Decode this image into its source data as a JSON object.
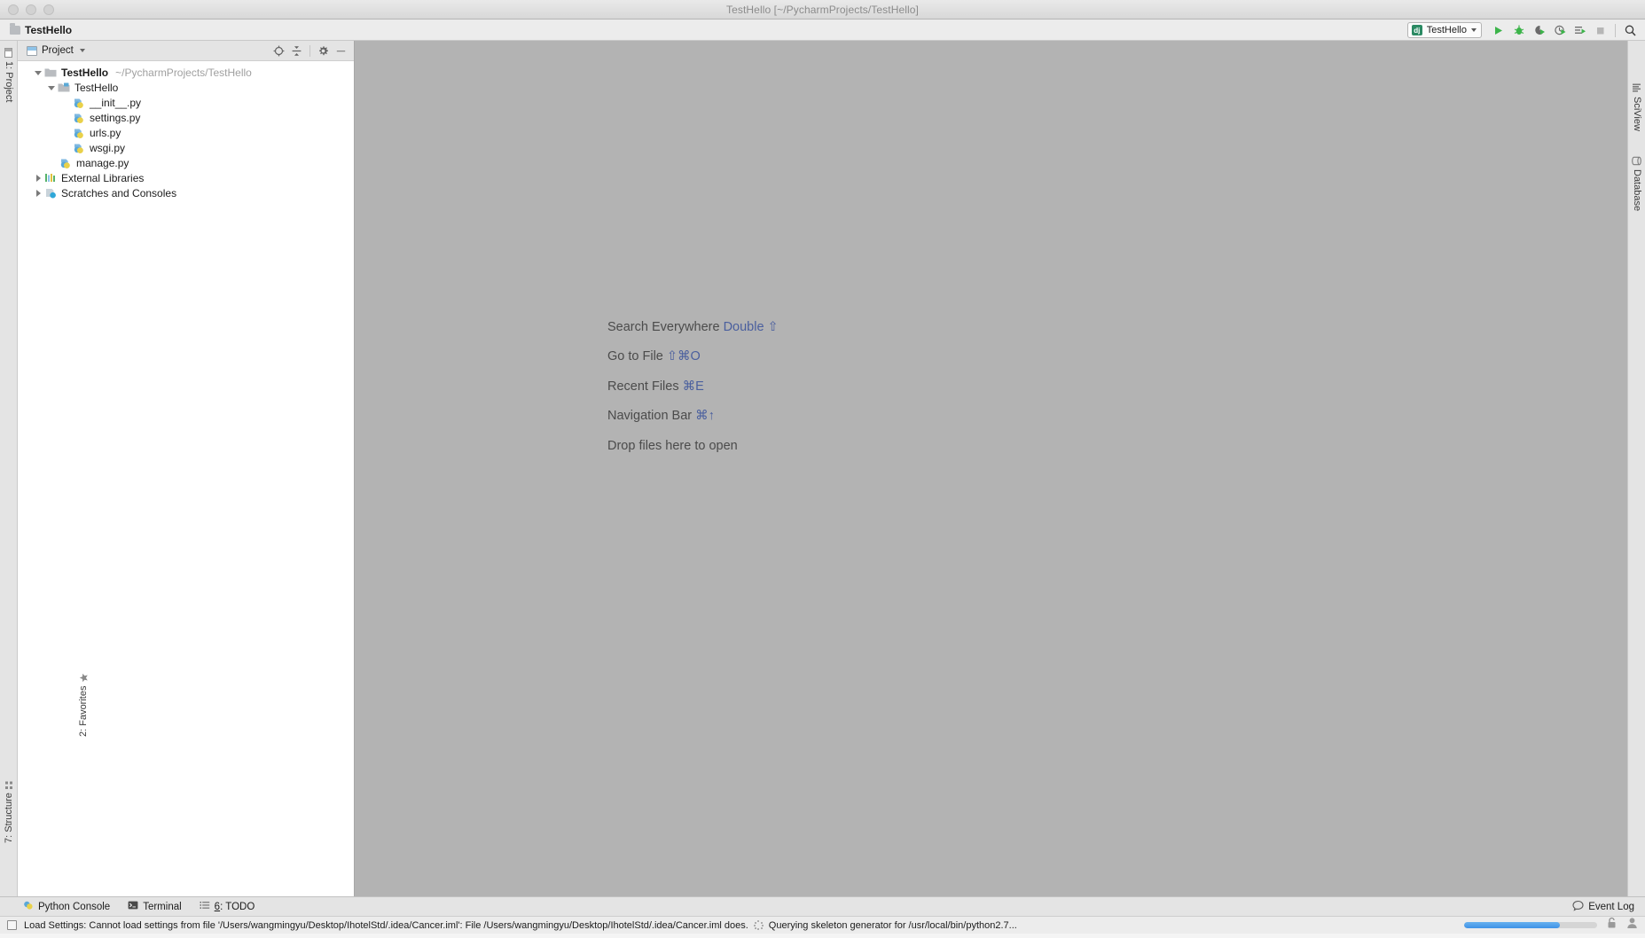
{
  "window": {
    "title": "TestHello [~/PycharmProjects/TestHello]",
    "traffic_lights": [
      "close",
      "minimize",
      "zoom"
    ]
  },
  "toolbar": {
    "project_name": "TestHello",
    "project_icon": "folder-icon",
    "run_config": {
      "label": "TestHello",
      "icon_letter": "dj",
      "caret": "chevron-down-icon"
    },
    "buttons": [
      {
        "name": "run-button",
        "icon": "play-icon"
      },
      {
        "name": "debug-button",
        "icon": "bug-icon"
      },
      {
        "name": "run-with-coverage-button",
        "icon": "coverage-icon"
      },
      {
        "name": "profile-button",
        "icon": "profile-icon"
      },
      {
        "name": "run-dashboard-button",
        "icon": "run-list-icon"
      },
      {
        "name": "stop-button",
        "icon": "stop-icon"
      },
      {
        "name": "search-button",
        "icon": "search-icon"
      }
    ]
  },
  "left_stripe": {
    "tabs": [
      {
        "name": "sidebar-tab-project",
        "label": "1: Project",
        "icon": "project-icon",
        "selected": true
      },
      {
        "name": "sidebar-tab-favorites",
        "label": "2: Favorites",
        "icon": "star-icon",
        "selected": false
      },
      {
        "name": "sidebar-tab-structure",
        "label": "7: Structure",
        "icon": "structure-icon",
        "selected": false
      }
    ]
  },
  "right_stripe": {
    "tabs": [
      {
        "name": "sidebar-tab-sciview",
        "label": "SciView",
        "icon": "sciview-icon"
      },
      {
        "name": "sidebar-tab-database",
        "label": "Database",
        "icon": "database-icon"
      }
    ]
  },
  "project_panel": {
    "header": {
      "title": "Project",
      "icon": "project-window-icon",
      "caret": "chevron-down-icon",
      "actions": [
        {
          "name": "select-opened-file-button",
          "icon": "target-icon"
        },
        {
          "name": "collapse-all-button",
          "icon": "collapse-all-icon"
        },
        {
          "name": "settings-button",
          "icon": "gear-icon"
        },
        {
          "name": "hide-panel-button",
          "icon": "minimize-icon"
        }
      ]
    },
    "tree": [
      {
        "label": "TestHello",
        "path": "~/PycharmProjects/TestHello",
        "icon": "folder-icon",
        "indent": 0,
        "arrow": "open",
        "bold": true
      },
      {
        "label": "TestHello",
        "path": "",
        "icon": "module-folder-icon",
        "indent": 1,
        "arrow": "open",
        "bold": false
      },
      {
        "label": "__init__.py",
        "path": "",
        "icon": "python-file-icon",
        "indent": 2,
        "arrow": "none",
        "bold": false
      },
      {
        "label": "settings.py",
        "path": "",
        "icon": "python-file-icon",
        "indent": 2,
        "arrow": "none",
        "bold": false
      },
      {
        "label": "urls.py",
        "path": "",
        "icon": "python-file-icon",
        "indent": 2,
        "arrow": "none",
        "bold": false
      },
      {
        "label": "wsgi.py",
        "path": "",
        "icon": "python-file-icon",
        "indent": 2,
        "arrow": "none",
        "bold": false
      },
      {
        "label": "manage.py",
        "path": "",
        "icon": "python-file-icon",
        "indent": 1,
        "arrow": "none",
        "bold": false
      },
      {
        "label": "External Libraries",
        "path": "",
        "icon": "libraries-icon",
        "indent": 0,
        "arrow": "closed",
        "bold": false
      },
      {
        "label": "Scratches and Consoles",
        "path": "",
        "icon": "scratches-icon",
        "indent": 0,
        "arrow": "closed",
        "bold": false
      }
    ]
  },
  "editor": {
    "hints": [
      {
        "name": "hint-search-everywhere",
        "text": "Search Everywhere ",
        "shortcut": "Double ⇧"
      },
      {
        "name": "hint-go-to-file",
        "text": "Go to File ",
        "shortcut": "⇧⌘O"
      },
      {
        "name": "hint-recent-files",
        "text": "Recent Files ",
        "shortcut": "⌘E"
      },
      {
        "name": "hint-navigation-bar",
        "text": "Navigation Bar ",
        "shortcut": "⌘↑"
      },
      {
        "name": "hint-drop-files",
        "text": "Drop files here to open",
        "shortcut": ""
      }
    ]
  },
  "bottom_tabs": {
    "items": [
      {
        "name": "bottom-tab-python-console",
        "label": "Python Console",
        "icon": "python-icon"
      },
      {
        "name": "bottom-tab-terminal",
        "label": "Terminal",
        "icon": "terminal-icon"
      },
      {
        "name": "bottom-tab-todo",
        "label_prefix": "6",
        "label_suffix": ": TODO",
        "icon": "todo-icon"
      }
    ],
    "event_log": {
      "label": "Event Log",
      "icon": "event-log-icon"
    }
  },
  "status_bar": {
    "message": "Load Settings: Cannot load settings from file '/Users/wangmingyu/Desktop/IhotelStd/.idea/Cancer.iml': File /Users/wangmingyu/Desktop/IhotelStd/.idea/Cancer.iml does.",
    "secondary_message": "Querying skeleton generator for /usr/local/bin/python2.7...",
    "progress_percent": 72,
    "icons": [
      {
        "name": "lock-icon"
      },
      {
        "name": "user-icon"
      }
    ]
  },
  "colors": {
    "accent_blue": "#4a5f9e",
    "progress_blue": "#3f93e8",
    "run_green": "#2b8a63",
    "editor_bg": "#b3b3b3",
    "panel_bg": "#ffffff",
    "chrome_bg": "#ececec"
  }
}
